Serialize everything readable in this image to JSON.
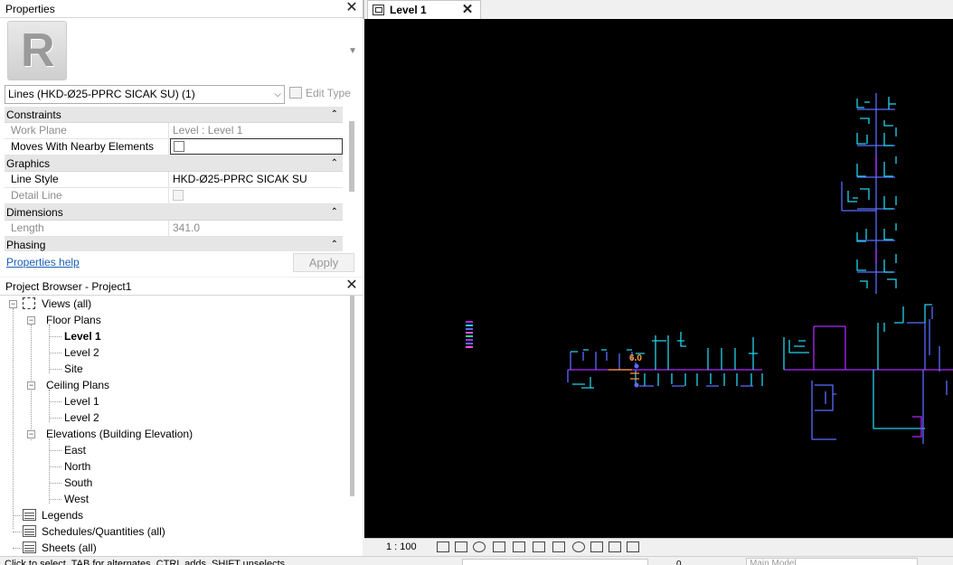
{
  "properties": {
    "title": "Properties",
    "close": "✕",
    "type_selector": "Lines (HKD-Ø25-PPRC SICAK SU) (1)",
    "edit_type": "Edit Type",
    "categories": [
      {
        "name": "Constraints",
        "toggle": "⌃",
        "rows": [
          {
            "key": "Work Plane",
            "value": "Level : Level 1",
            "editable": false
          },
          {
            "key": "Moves With Nearby Elements",
            "value": "",
            "checkbox": true,
            "editable": true
          }
        ]
      },
      {
        "name": "Graphics",
        "toggle": "⌃",
        "rows": [
          {
            "key": "Line Style",
            "value": "HKD-Ø25-PPRC SICAK SU",
            "editable": true
          },
          {
            "key": "Detail Line",
            "value": "",
            "checkbox": true,
            "editable": false
          }
        ]
      },
      {
        "name": "Dimensions",
        "toggle": "⌃",
        "rows": [
          {
            "key": "Length",
            "value": "341.0",
            "editable": false
          }
        ]
      },
      {
        "name": "Phasing",
        "toggle": "⌃",
        "rows": []
      }
    ],
    "help_link": "Properties help",
    "apply": "Apply"
  },
  "browser": {
    "title": "Project Browser - Project1",
    "close": "✕",
    "nodes": [
      {
        "label": "Views (all)",
        "level": 0,
        "expand": "−"
      },
      {
        "label": "Floor Plans",
        "level": 1,
        "expand": "−"
      },
      {
        "label": "Level 1",
        "level": 2,
        "bold": true
      },
      {
        "label": "Level 2",
        "level": 2
      },
      {
        "label": "Site",
        "level": 2
      },
      {
        "label": "Ceiling Plans",
        "level": 1,
        "expand": "−"
      },
      {
        "label": "Level 1",
        "level": 2
      },
      {
        "label": "Level 2",
        "level": 2
      },
      {
        "label": "Elevations (Building Elevation)",
        "level": 1,
        "expand": "−"
      },
      {
        "label": "East",
        "level": 2
      },
      {
        "label": "North",
        "level": 2
      },
      {
        "label": "South",
        "level": 2
      },
      {
        "label": "West",
        "level": 2
      },
      {
        "label": "Legends",
        "level": 0,
        "icon": true
      },
      {
        "label": "Schedules/Quantities (all)",
        "level": 0,
        "icon": true
      },
      {
        "label": "Sheets (all)",
        "level": 0,
        "icon": true
      }
    ]
  },
  "view_tab": {
    "label": "Level 1",
    "close": "✕"
  },
  "canvas": {
    "dimension_text": "6.0"
  },
  "view_control_bar": {
    "scale": "1 : 100"
  },
  "status_bar": {
    "hint": "Click to select, TAB for alternates, CTRL adds, SHIFT unselects.",
    "selection_count": "0",
    "model": "Main Model"
  },
  "colors": {
    "canvas_bg": "#000000",
    "pipe_blue": "#5a6cff",
    "pipe_cyan": "#22d3ee",
    "pipe_magenta": "#b026ff",
    "dimension": "#ff9d2e"
  }
}
